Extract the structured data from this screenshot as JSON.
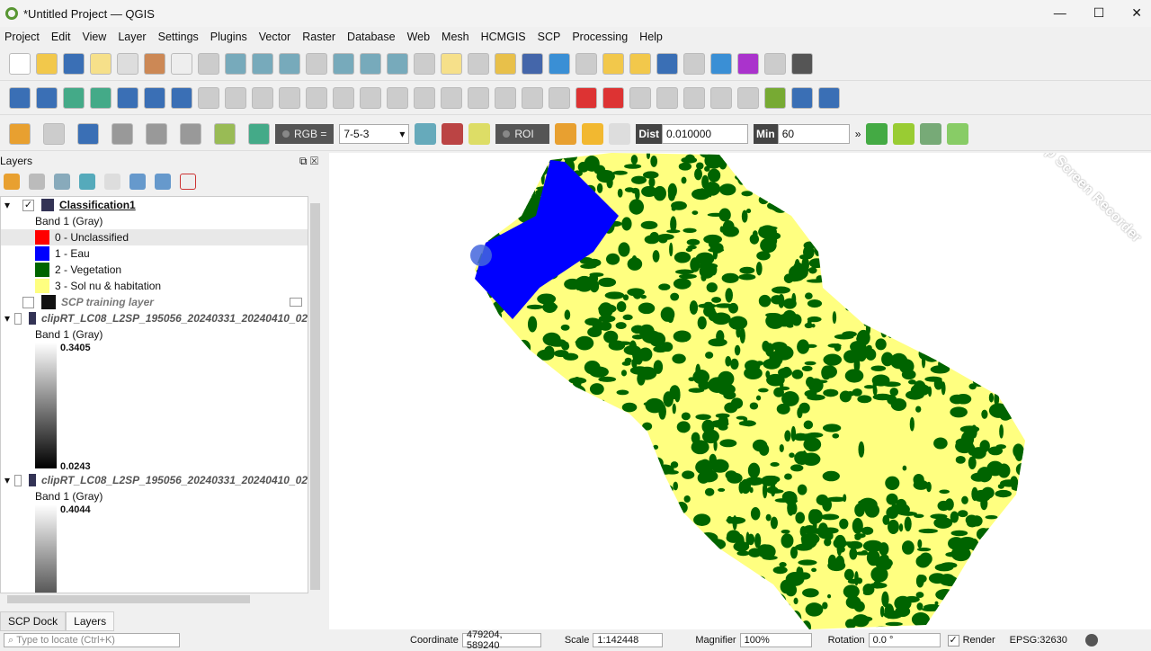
{
  "window": {
    "title": "*Untitled Project — QGIS",
    "min": "—",
    "max": "☐",
    "close": "✕"
  },
  "menu": [
    "Project",
    "Edit",
    "View",
    "Layer",
    "Settings",
    "Plugins",
    "Vector",
    "Raster",
    "Database",
    "Web",
    "Mesh",
    "HCMGIS",
    "SCP",
    "Processing",
    "Help"
  ],
  "toolbar1": [
    [
      "new-project-icon",
      "#fff"
    ],
    [
      "open-project-icon",
      "#f2c84b"
    ],
    [
      "save-project-icon",
      "#3a6fb5"
    ],
    [
      "print-layout-icon",
      "#f6e08a"
    ],
    [
      "layout-manager-icon",
      "#ddd"
    ],
    [
      "style-manager-icon",
      "#c85"
    ],
    [
      "pan-icon",
      "#eee"
    ],
    [
      "pan-to-selection-icon",
      "#ccc"
    ],
    [
      "zoom-in-icon",
      "#7ab"
    ],
    [
      "zoom-out-icon",
      "#7ab"
    ],
    [
      "zoom-full-icon",
      "#7ab"
    ],
    [
      "zoom-selection-icon",
      "#ccc"
    ],
    [
      "zoom-layer-icon",
      "#7ab"
    ],
    [
      "zoom-native-icon",
      "#7ab"
    ],
    [
      "zoom-last-icon",
      "#7ab"
    ],
    [
      "zoom-next-icon",
      "#ccc"
    ],
    [
      "new-bookmark-icon",
      "#f6e08a"
    ],
    [
      "show-bookmarks-icon",
      "#ccc"
    ],
    [
      "temporal-icon",
      "#e8c04a"
    ],
    [
      "map-tips-icon",
      "#46a"
    ],
    [
      "refresh-icon",
      "#3a8fd5"
    ],
    [
      "select-icon",
      "#ccc"
    ],
    [
      "deselect-icon",
      "#f2c84b"
    ],
    [
      "select-location-icon",
      "#f2c84b"
    ],
    [
      "identify-icon",
      "#3a6fb5"
    ],
    [
      "attributes-icon",
      "#ccc"
    ],
    [
      "settings-icon",
      "#3a8fd5"
    ],
    [
      "sum-icon",
      "#a3c"
    ],
    [
      "table-icon",
      "#ccc"
    ],
    [
      "measure-icon",
      "#555"
    ]
  ],
  "toolbar2": [
    [
      "add-vector-icon",
      "#3a6fb5"
    ],
    [
      "add-raster-icon",
      "#3a6fb5"
    ],
    [
      "add-delimited-icon",
      "#4a8"
    ],
    [
      "add-spatialite-icon",
      "#4a8"
    ],
    [
      "add-wms-icon",
      "#3a6fb5"
    ],
    [
      "add-wcs-icon",
      "#3a6fb5"
    ],
    [
      "add-wfs-icon",
      "#3a6fb5"
    ],
    [
      "edit-pencil-icon",
      "#ccc"
    ],
    [
      "digitize-icon",
      "#ccc"
    ],
    [
      "save-edits-icon",
      "#ccc"
    ],
    [
      "add-feature-icon",
      "#ccc"
    ],
    [
      "move-feature-icon",
      "#ccc"
    ],
    [
      "node-tool-icon",
      "#ccc"
    ],
    [
      "delete-icon",
      "#ccc"
    ],
    [
      "cut-icon",
      "#ccc"
    ],
    [
      "copy-icon",
      "#ccc"
    ],
    [
      "paste-icon",
      "#ccc"
    ],
    [
      "undo-icon",
      "#ccc"
    ],
    [
      "redo-icon",
      "#ccc"
    ],
    [
      "label-icon",
      "#ccc"
    ],
    [
      "label-pin-icon",
      "#ccc"
    ],
    [
      "label-highlight-icon",
      "#d33"
    ],
    [
      "label-abc-icon",
      "#d33"
    ],
    [
      "label-show-icon",
      "#ccc"
    ],
    [
      "label-move-icon",
      "#ccc"
    ],
    [
      "label-rotate-icon",
      "#ccc"
    ],
    [
      "label-change-icon",
      "#ccc"
    ],
    [
      "label-props-icon",
      "#ccc"
    ],
    [
      "grass-icon",
      "#7a3"
    ],
    [
      "python-icon",
      "#3a6fb5"
    ],
    [
      "help-icon",
      "#3a6fb5"
    ]
  ],
  "toolbar3a": [
    [
      "scp-pencil-icon",
      "#e8a030"
    ],
    [
      "scp-shield-icon",
      "#ccc"
    ],
    [
      "globe-icon",
      "#3a6fb5"
    ],
    [
      "band-calc-icon",
      "#999"
    ],
    [
      "band-set-icon",
      "#999"
    ],
    [
      "download-icon",
      "#999"
    ],
    [
      "scp-home-icon",
      "#9b5"
    ],
    [
      "zoom-preview-icon",
      "#4a8"
    ]
  ],
  "scp": {
    "rgb_label": "RGB =",
    "rgb_value": "7-5-3",
    "roi_label": "ROI",
    "dist_label": "Dist",
    "dist_value": "0.010000",
    "min_label": "Min",
    "min_value": "60",
    "more": "»"
  },
  "layers_panel": {
    "title": "Layers",
    "items": [
      {
        "name": "Classification1",
        "checked": true,
        "band": "Band 1 (Gray)",
        "classes": [
          {
            "label": "0 - Unclassified",
            "color": "#ff0000"
          },
          {
            "label": "1 - Eau",
            "color": "#0000ff"
          },
          {
            "label": "2 - Vegetation",
            "color": "#006400"
          },
          {
            "label": "3 - Sol nu & habitation",
            "color": "#ffff80"
          }
        ]
      },
      {
        "name": "SCP training layer"
      },
      {
        "name": "clipRT_LC08_L2SP_195056_20240331_20240410_02",
        "band": "Band 1 (Gray)",
        "max": "0.3405",
        "min": "0.0243"
      },
      {
        "name": "clipRT_LC08_L2SP_195056_20240331_20240410_02",
        "band": "Band 1 (Gray)",
        "max": "0.4044"
      }
    ]
  },
  "tabs": [
    "SCP Dock",
    "Layers"
  ],
  "status": {
    "locate_placeholder": "Type to locate (Ctrl+K)",
    "coordinate_label": "Coordinate",
    "coordinate": "479204, 589240",
    "scale_label": "Scale",
    "scale": "1:142448",
    "magnifier_label": "Magnifier",
    "magnifier": "100%",
    "rotation_label": "Rotation",
    "rotation": "0.0 °",
    "render_label": "Render",
    "crs": "EPSG:32630"
  },
  "watermark": "iTop Screen Recorder",
  "colors": {
    "water": "#0000ff",
    "vegetation": "#006400",
    "soil": "#ffff80"
  }
}
